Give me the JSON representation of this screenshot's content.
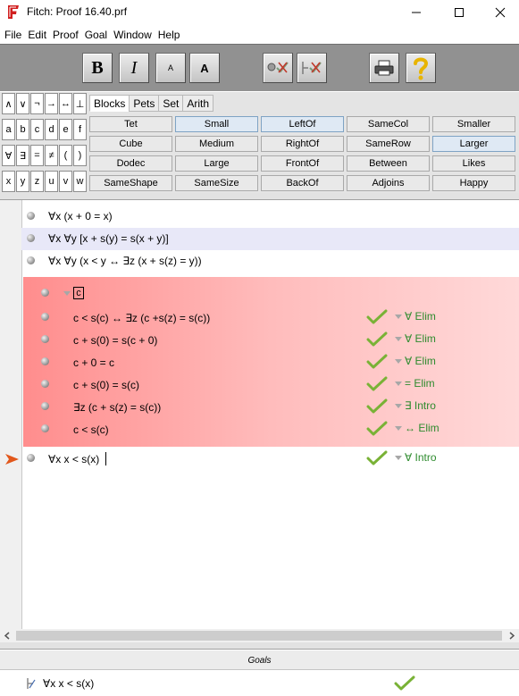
{
  "window": {
    "title": "Fitch: Proof 16.40.prf"
  },
  "menu": [
    "File",
    "Edit",
    "Proof",
    "Goal",
    "Window",
    "Help"
  ],
  "toolbar": {
    "bold_label": "B",
    "italic_label": "I",
    "small_font_label": "A",
    "large_font_label": "A"
  },
  "keypad": {
    "keys": [
      "∧",
      "∨",
      "¬",
      "→",
      "↔",
      "⊥",
      "a",
      "b",
      "c",
      "d",
      "e",
      "f",
      "∀",
      "∃",
      "=",
      "≠",
      "(",
      ")",
      "x",
      "y",
      "z",
      "u",
      "v",
      "w"
    ]
  },
  "predicates": {
    "tabs": [
      "Blocks",
      "Pets",
      "Set",
      "Arith"
    ],
    "active_tab": "Blocks",
    "buttons": [
      [
        "Tet",
        "Small",
        "LeftOf",
        "SameCol",
        "Smaller"
      ],
      [
        "Cube",
        "Medium",
        "RightOf",
        "SameRow",
        "Larger"
      ],
      [
        "Dodec",
        "Large",
        "FrontOf",
        "Between",
        "Likes"
      ],
      [
        "SameShape",
        "SameSize",
        "BackOf",
        "Adjoins",
        "Happy"
      ]
    ]
  },
  "proof": {
    "premises": [
      "∀x (x + 0 = x)",
      "∀x ∀y [x + s(y) = s(x + y)]",
      "∀x ∀y (x < y ↔ ∃z (x + s(z) = y))"
    ],
    "subproof": {
      "boxed_constant": "c",
      "steps": [
        {
          "formula": "c < s(c) ↔ ∃z (c +s(z) = s(c))",
          "rule": "∀ Elim"
        },
        {
          "formula": "c + s(0) = s(c + 0)",
          "rule": "∀ Elim"
        },
        {
          "formula": "c + 0 = c",
          "rule": "∀ Elim"
        },
        {
          "formula": "c + s(0) = s(c)",
          "rule": "= Elim"
        },
        {
          "formula": "∃z (c + s(z) = s(c))",
          "rule": "∃ Intro"
        },
        {
          "formula": "c < s(c)",
          "rule": "↔ Elim"
        }
      ]
    },
    "conclusion": {
      "formula": "∀x x < s(x)",
      "rule": "∀ Intro"
    }
  },
  "goals": {
    "title": "Goals",
    "items": [
      {
        "formula": "∀x x < s(x)"
      }
    ]
  },
  "colors": {
    "toolbar_bg": "#919191",
    "rule_green": "#2e8b2e",
    "subproof_red": "#ff8d8d",
    "check_green": "#79b236",
    "highlight_row": "#e8e8f8"
  }
}
